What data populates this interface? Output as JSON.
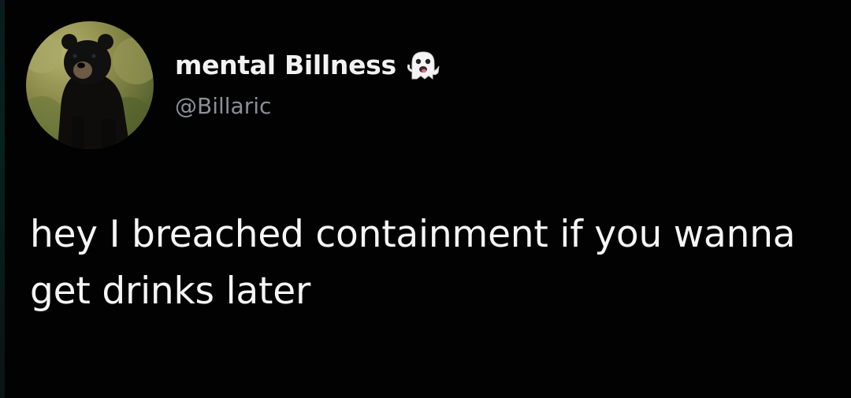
{
  "author": {
    "display_name": "mental Billness",
    "handle": "@Billaric",
    "badge_icon": "ghost-emoji-icon",
    "avatar_icon": "bear-avatar"
  },
  "tweet": {
    "text": "hey I breached containment if you wanna get drinks later"
  },
  "colors": {
    "background": "#000000",
    "primary_text": "#f2f2f2",
    "secondary_text": "#8b9096"
  }
}
